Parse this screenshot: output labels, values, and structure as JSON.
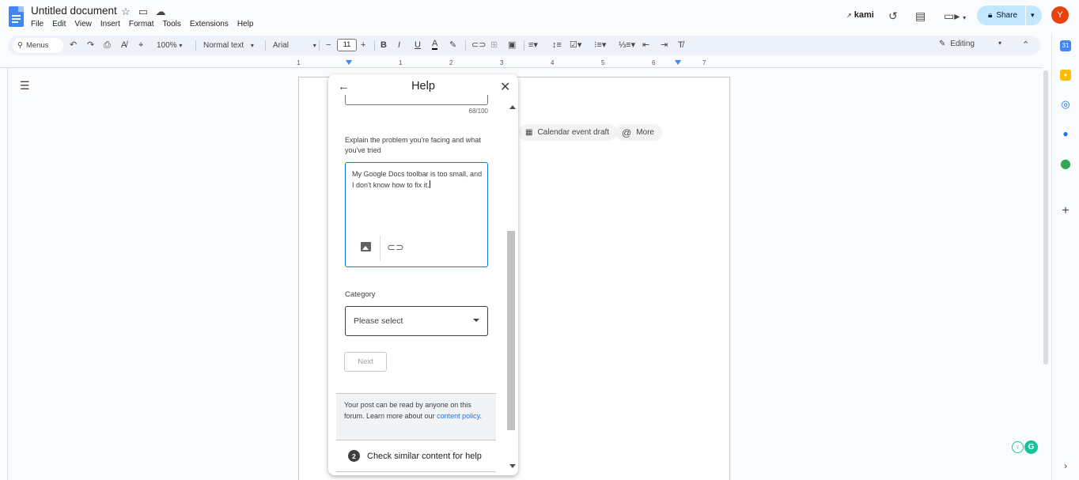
{
  "header": {
    "doc_title": "Untitled document",
    "menu": [
      "File",
      "Edit",
      "View",
      "Insert",
      "Format",
      "Tools",
      "Extensions",
      "Help"
    ],
    "kami_label": "kami",
    "share_label": "Share",
    "avatar_letter": "Y"
  },
  "toolbar": {
    "menus_label": "Menus",
    "zoom": "100%",
    "style": "Normal text",
    "font": "Arial",
    "font_size": "11",
    "mode": "Editing"
  },
  "ruler": {
    "labels": [
      "1",
      "1",
      "2",
      "3",
      "4",
      "5",
      "6",
      "7"
    ]
  },
  "document": {
    "chips": [
      "Calendar event draft",
      "More"
    ]
  },
  "help_panel": {
    "title": "Help",
    "title_counter": "68/100",
    "explain_label": "Explain the problem you're facing and what you've tried",
    "description": "My Google Docs toolbar is too small, and I don't know how to fix it.",
    "category_label": "Category",
    "category_value": "Please select",
    "next_label": "Next",
    "notice_text": "Your post can be read by anyone on this forum. Learn more about our ",
    "notice_link": "content policy",
    "notice_end": ".",
    "step_number": "2",
    "step_label": "Check similar content for help"
  },
  "colors": {
    "accent": "#1a73e8",
    "share_bg": "#c2e7ff",
    "avatar_bg": "#e8430e",
    "toolbar_bg": "#edf2fa"
  }
}
